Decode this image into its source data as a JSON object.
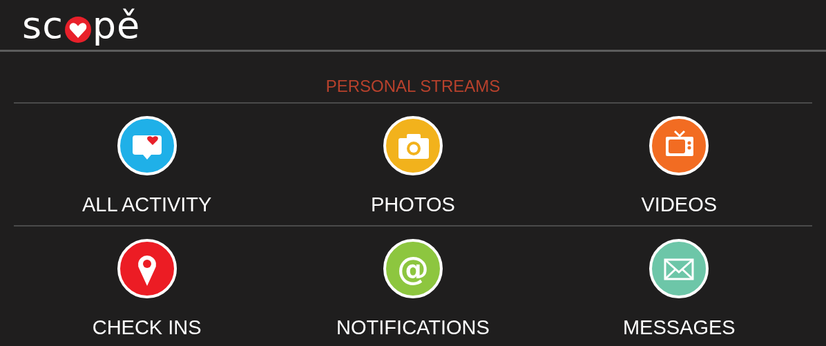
{
  "logo": {
    "before": "sc",
    "after": "pě"
  },
  "section_title": "PERSONAL STREAMS",
  "rows": [
    [
      {
        "label": "ALL ACTIVITY",
        "kind": "chat",
        "color": "#1fb0e8"
      },
      {
        "label": "PHOTOS",
        "kind": "camera",
        "color": "#f2b21c"
      },
      {
        "label": "VIDEOS",
        "kind": "tv",
        "color": "#f26c22"
      }
    ],
    [
      {
        "label": "CHECK INS",
        "kind": "pin",
        "color": "#ec1c24"
      },
      {
        "label": "NOTIFICATIONS",
        "kind": "at",
        "glyph": "@",
        "color": "#8dc63f"
      },
      {
        "label": "MESSAGES",
        "kind": "mail",
        "color": "#6dc6a8"
      }
    ]
  ]
}
